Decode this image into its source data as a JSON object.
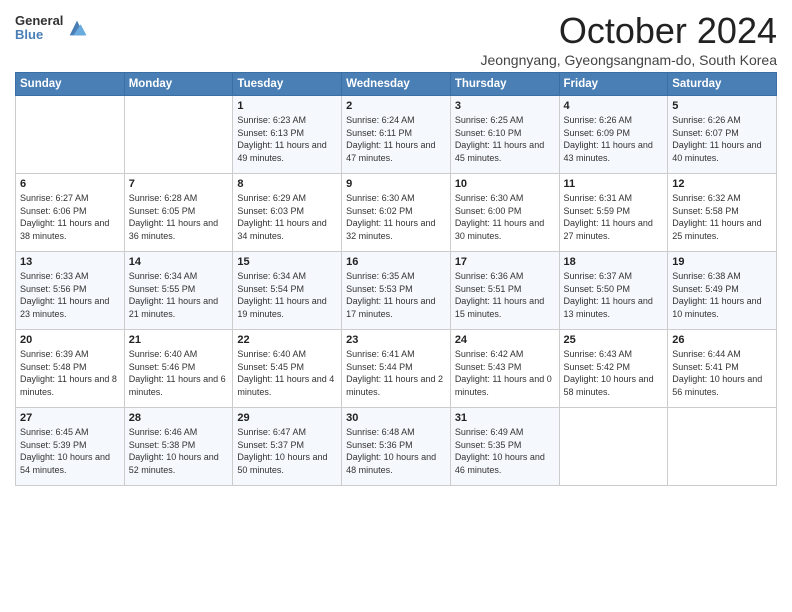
{
  "logo": {
    "general": "General",
    "blue": "Blue"
  },
  "title": "October 2024",
  "subtitle": "Jeongnyang, Gyeongsangnm-do, South Korea",
  "subtitle_full": "Jeongnyang, Gyeongsangnam-do, South Korea",
  "days_of_week": [
    "Sunday",
    "Monday",
    "Tuesday",
    "Wednesday",
    "Thursday",
    "Friday",
    "Saturday"
  ],
  "weeks": [
    [
      {
        "day": "",
        "info": ""
      },
      {
        "day": "",
        "info": ""
      },
      {
        "day": "1",
        "sunrise": "6:23 AM",
        "sunset": "6:13 PM",
        "daylight": "11 hours and 49 minutes."
      },
      {
        "day": "2",
        "sunrise": "6:24 AM",
        "sunset": "6:11 PM",
        "daylight": "11 hours and 47 minutes."
      },
      {
        "day": "3",
        "sunrise": "6:25 AM",
        "sunset": "6:10 PM",
        "daylight": "11 hours and 45 minutes."
      },
      {
        "day": "4",
        "sunrise": "6:26 AM",
        "sunset": "6:09 PM",
        "daylight": "11 hours and 43 minutes."
      },
      {
        "day": "5",
        "sunrise": "6:26 AM",
        "sunset": "6:07 PM",
        "daylight": "11 hours and 40 minutes."
      }
    ],
    [
      {
        "day": "6",
        "sunrise": "6:27 AM",
        "sunset": "6:06 PM",
        "daylight": "11 hours and 38 minutes."
      },
      {
        "day": "7",
        "sunrise": "6:28 AM",
        "sunset": "6:05 PM",
        "daylight": "11 hours and 36 minutes."
      },
      {
        "day": "8",
        "sunrise": "6:29 AM",
        "sunset": "6:03 PM",
        "daylight": "11 hours and 34 minutes."
      },
      {
        "day": "9",
        "sunrise": "6:30 AM",
        "sunset": "6:02 PM",
        "daylight": "11 hours and 32 minutes."
      },
      {
        "day": "10",
        "sunrise": "6:30 AM",
        "sunset": "6:00 PM",
        "daylight": "11 hours and 30 minutes."
      },
      {
        "day": "11",
        "sunrise": "6:31 AM",
        "sunset": "5:59 PM",
        "daylight": "11 hours and 27 minutes."
      },
      {
        "day": "12",
        "sunrise": "6:32 AM",
        "sunset": "5:58 PM",
        "daylight": "11 hours and 25 minutes."
      }
    ],
    [
      {
        "day": "13",
        "sunrise": "6:33 AM",
        "sunset": "5:56 PM",
        "daylight": "11 hours and 23 minutes."
      },
      {
        "day": "14",
        "sunrise": "6:34 AM",
        "sunset": "5:55 PM",
        "daylight": "11 hours and 21 minutes."
      },
      {
        "day": "15",
        "sunrise": "6:34 AM",
        "sunset": "5:54 PM",
        "daylight": "11 hours and 19 minutes."
      },
      {
        "day": "16",
        "sunrise": "6:35 AM",
        "sunset": "5:53 PM",
        "daylight": "11 hours and 17 minutes."
      },
      {
        "day": "17",
        "sunrise": "6:36 AM",
        "sunset": "5:51 PM",
        "daylight": "11 hours and 15 minutes."
      },
      {
        "day": "18",
        "sunrise": "6:37 AM",
        "sunset": "5:50 PM",
        "daylight": "11 hours and 13 minutes."
      },
      {
        "day": "19",
        "sunrise": "6:38 AM",
        "sunset": "5:49 PM",
        "daylight": "11 hours and 10 minutes."
      }
    ],
    [
      {
        "day": "20",
        "sunrise": "6:39 AM",
        "sunset": "5:48 PM",
        "daylight": "11 hours and 8 minutes."
      },
      {
        "day": "21",
        "sunrise": "6:40 AM",
        "sunset": "5:46 PM",
        "daylight": "11 hours and 6 minutes."
      },
      {
        "day": "22",
        "sunrise": "6:40 AM",
        "sunset": "5:45 PM",
        "daylight": "11 hours and 4 minutes."
      },
      {
        "day": "23",
        "sunrise": "6:41 AM",
        "sunset": "5:44 PM",
        "daylight": "11 hours and 2 minutes."
      },
      {
        "day": "24",
        "sunrise": "6:42 AM",
        "sunset": "5:43 PM",
        "daylight": "11 hours and 0 minutes."
      },
      {
        "day": "25",
        "sunrise": "6:43 AM",
        "sunset": "5:42 PM",
        "daylight": "10 hours and 58 minutes."
      },
      {
        "day": "26",
        "sunrise": "6:44 AM",
        "sunset": "5:41 PM",
        "daylight": "10 hours and 56 minutes."
      }
    ],
    [
      {
        "day": "27",
        "sunrise": "6:45 AM",
        "sunset": "5:39 PM",
        "daylight": "10 hours and 54 minutes."
      },
      {
        "day": "28",
        "sunrise": "6:46 AM",
        "sunset": "5:38 PM",
        "daylight": "10 hours and 52 minutes."
      },
      {
        "day": "29",
        "sunrise": "6:47 AM",
        "sunset": "5:37 PM",
        "daylight": "10 hours and 50 minutes."
      },
      {
        "day": "30",
        "sunrise": "6:48 AM",
        "sunset": "5:36 PM",
        "daylight": "10 hours and 48 minutes."
      },
      {
        "day": "31",
        "sunrise": "6:49 AM",
        "sunset": "5:35 PM",
        "daylight": "10 hours and 46 minutes."
      },
      {
        "day": "",
        "info": ""
      },
      {
        "day": "",
        "info": ""
      }
    ]
  ]
}
